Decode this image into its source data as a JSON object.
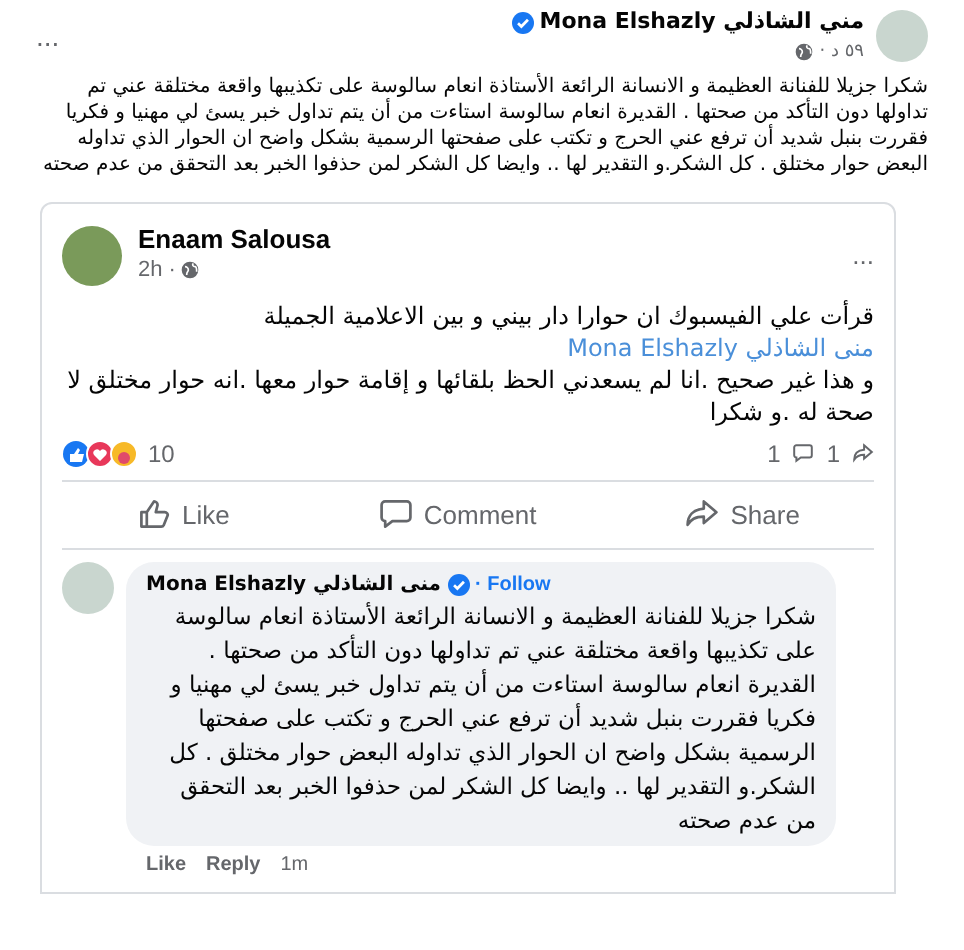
{
  "post": {
    "author": "مني الشاذلي Mona Elshazly",
    "verified": true,
    "time": "٥٩ د ·",
    "more": "...",
    "text": "شكرا جزيلا للفنانة العظيمة و الانسانة الرائعة الأستاذة انعام سالوسة على تكذيبها واقعة مختلقة  عني  تم تداولها دون التأكد من صحتها . القديرة انعام سالوسة استاءت من أن يتم تداول خبر يسئ لي مهنيا و فكريا فقررت بنبل شديد أن ترفع عني الحرج و تكتب على صفحتها الرسمية بشكل واضح ان الحوار الذي تداوله البعض حوار مختلق .  كل الشكر.و التقدير لها .. وايضا كل الشكر لمن حذفوا الخبر بعد التحقق من عدم صحته"
  },
  "shared": {
    "author": "Enaam Salousa",
    "time": "2h ·",
    "more": "...",
    "text": "قرأت علي الفيسبوك ان حوارا دار  بيني و بين الاعلامية الجميلة",
    "mention": "منى الشاذلي Mona Elshazly",
    "text_2": "و هذا غير صحيح .انا لم يسعدني الحظ بلقائها  و إقامة حوار معها .انه حوار مختلق لا صحة له .و شكرا",
    "reaction_count": "10",
    "comment_count": "1",
    "share_count": "1",
    "like_action": "Like",
    "comment_action": "Comment",
    "share_action": "Share"
  },
  "comment": {
    "author": "Mona Elshazly منى الشاذلي",
    "verified": true,
    "follow": "· Follow",
    "text": "شكرا جزيلا للفنانة العظيمة و الانسانة الرائعة الأستاذة انعام سالوسة على تكذيبها واقعة مختلقة عني تم تداولها دون التأكد من صحتها . القديرة انعام سالوسة استاءت من أن يتم تداول خبر يسئ لي مهنيا و فكريا فقررت بنبل شديد أن ترفع عني الحرج و تكتب على صفحتها الرسمية بشكل واضح ان الحوار الذي تداوله البعض حوار مختلق . كل الشكر.و التقدير لها .. وايضا كل الشكر لمن حذفوا الخبر بعد التحقق من عدم صحته",
    "like_action": "Like",
    "reply_action": "Reply",
    "time": "1m"
  }
}
